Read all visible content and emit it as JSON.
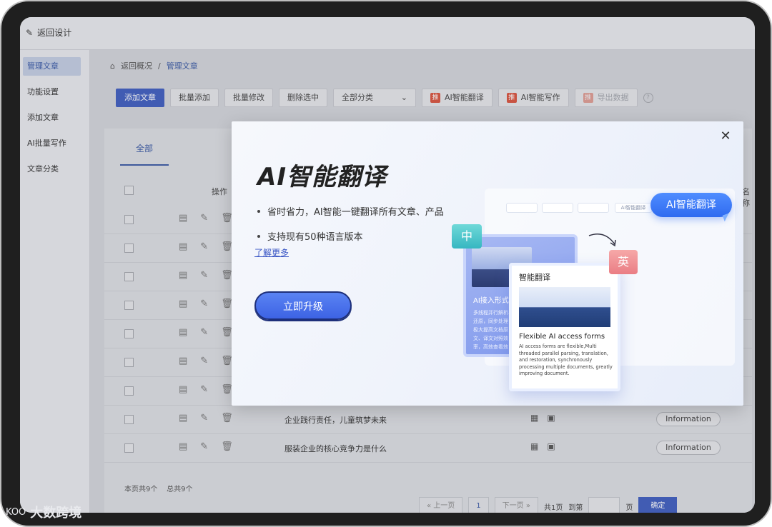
{
  "header": {
    "back_label": "返回设计"
  },
  "sidebar": {
    "items": [
      {
        "label": "管理文章",
        "active": true
      },
      {
        "label": "功能设置",
        "active": false
      },
      {
        "label": "添加文章",
        "active": false
      },
      {
        "label": "AI批量写作",
        "active": false
      },
      {
        "label": "文章分类",
        "active": false
      }
    ]
  },
  "breadcrumb": {
    "home": "返回概况",
    "separator": "/",
    "current": "管理文章"
  },
  "toolbar": {
    "add": "添加文章",
    "batch_add": "批量添加",
    "batch_edit": "批量修改",
    "delete_selected": "删除选中",
    "category_select": "全部分类",
    "ai_translate": "AI智能翻译",
    "ai_write": "AI智能写作",
    "export": "导出数据",
    "tui_badge": "推",
    "help": "?"
  },
  "table": {
    "tab": "全部",
    "col_ops": "操作",
    "col_name": "名称",
    "rows": [
      {
        "title": "",
        "pill": ""
      },
      {
        "title": "",
        "pill": ""
      },
      {
        "title": "",
        "pill": ""
      },
      {
        "title": "",
        "pill": ""
      },
      {
        "title": "",
        "pill": ""
      },
      {
        "title": "",
        "pill": ""
      },
      {
        "title": "",
        "pill": ""
      },
      {
        "title": "企业践行责任，儿童筑梦未来",
        "pill": "Information"
      },
      {
        "title": "服装企业的核心竞争力是什么",
        "pill": "Information"
      }
    ]
  },
  "pagination": {
    "summary_page": "本页共9个",
    "summary_total": "总共9个",
    "prev": "上一页",
    "page": "1",
    "next": "下一页",
    "total_pages": "共1页",
    "goto": "到第",
    "page_unit": "页",
    "confirm": "确定"
  },
  "modal": {
    "title": "AI智能翻译",
    "bullets": [
      "省时省力，AI智能一键翻译所有文章、产品",
      "支持现有50种语言版本"
    ],
    "learn_more": "了解更多",
    "upgrade": "立即升级",
    "close_icon": "close-icon",
    "illustration": {
      "ai_button": "AI智能翻译",
      "tag_zh": "中",
      "tag_en": "英",
      "small_pill": "AI智能翻译",
      "left_card_title": "AI接入形式",
      "left_card_text": "多线程并行解析、还原，同步处理，极大提高文档原文、译文对照效率，高效查看效",
      "right_card_title": "智能翻译",
      "right_card_heading": "Flexible AI access forms",
      "right_card_body": "AI access forms are flexible,Multi threaded parallel parsing, translation, and restoration, synchronously processing multiple documents, greatly improving document."
    }
  },
  "watermark": {
    "logo": "KOO",
    "text": "大数跨境"
  },
  "colors": {
    "primary": "#3f5ec0",
    "accent": "#3d63e4",
    "link": "#3a56c5"
  }
}
